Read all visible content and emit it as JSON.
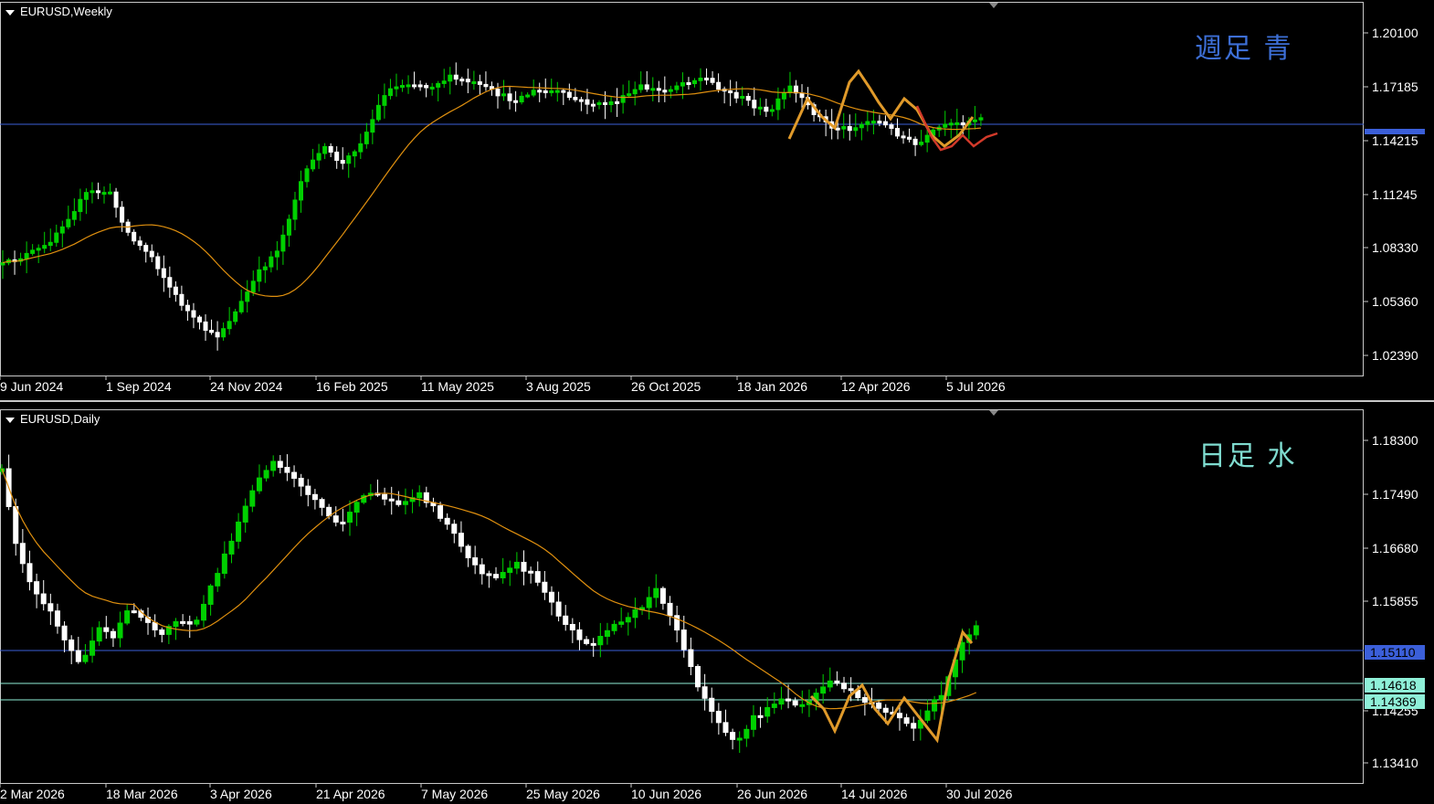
{
  "weekly": {
    "title": "EURUSD,Weekly",
    "annotation": "週足  青",
    "annotation_color": "#3d6fd6",
    "y_ticks": [
      "1.20100",
      "1.17185",
      "1.14215",
      "1.11245",
      "1.08330",
      "1.05360",
      "1.02390"
    ],
    "x_labels": [
      "9 Jun 2024",
      "1 Sep 2024",
      "24 Nov 2024",
      "16 Feb 2025",
      "11 May 2025",
      "3 Aug 2025",
      "26 Oct 2025",
      "18 Jan 2026",
      "12 Apr 2026",
      "5 Jul 2026"
    ]
  },
  "daily": {
    "title": "EURUSD,Daily",
    "annotation": "日足  水",
    "annotation_color": "#7fdcd0",
    "y_ticks": [
      "1.18300",
      "1.17490",
      "1.16680",
      "1.15855",
      "1.14255",
      "1.13410"
    ],
    "x_labels": [
      "2 Mar 2026",
      "18 Mar 2026",
      "3 Apr 2026",
      "21 Apr 2026",
      "7 May 2026",
      "25 May 2026",
      "10 Jun 2026",
      "26 Jun 2026",
      "14 Jul 2026",
      "30 Jul 2026"
    ],
    "price_tags": [
      {
        "label": "1.15110",
        "bg": "#3b5fd9",
        "fg": "#ffffff"
      },
      {
        "label": "1.14618",
        "bg": "#8ff0d8",
        "fg": "#000000"
      },
      {
        "label": "1.14369",
        "bg": "#8ff0d8",
        "fg": "#000000"
      }
    ]
  },
  "colors": {
    "bull": "#00d000",
    "bear": "#ffffff",
    "ma": "#e0900f",
    "zigzag": "#e09a2a",
    "zigzag_red": "#d23a2a",
    "h_blue": "#3b5fd9",
    "h_cyan": "#8ff0d8",
    "axis": "#c8c8c8"
  }
}
